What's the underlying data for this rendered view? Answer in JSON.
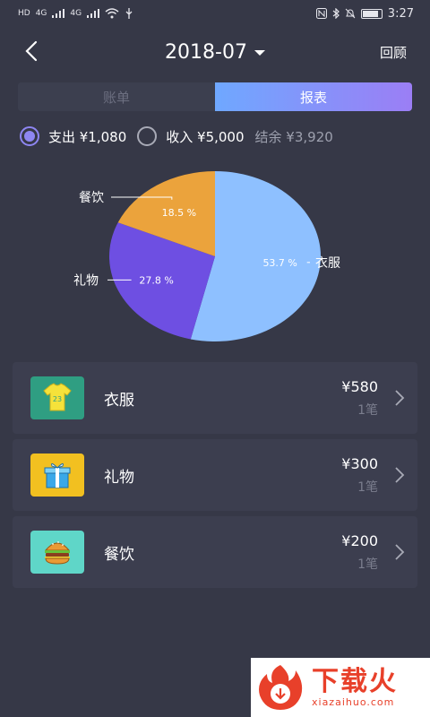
{
  "status_bar": {
    "left_icons": [
      "hd-icon",
      "signal-4g-icon",
      "signal-4g-icon",
      "wifi-icon",
      "usb-icon"
    ],
    "left_labels": [
      "HD",
      "4G",
      "4G"
    ],
    "right_icons": [
      "nfc-icon",
      "bluetooth-icon",
      "mute-icon",
      "battery-icon"
    ],
    "time": "3:27",
    "battery_level": 0.85
  },
  "nav": {
    "title": "2018-07",
    "review_label": "回顾"
  },
  "tabs": [
    {
      "label": "账单",
      "active": false
    },
    {
      "label": "报表",
      "active": true
    }
  ],
  "filter": {
    "expense_label": "支出 ¥1,080",
    "income_label": "收入 ¥5,000",
    "balance_label": "结余 ¥3,920",
    "selected": "expense"
  },
  "chart_data": {
    "type": "pie",
    "series": [
      {
        "name": "衣服",
        "value": 53.7,
        "label": "53.7 %",
        "color": "#8ec0ff"
      },
      {
        "name": "礼物",
        "value": 27.8,
        "label": "27.8 %",
        "color": "#6e4fe2"
      },
      {
        "name": "餐饮",
        "value": 18.5,
        "label": "18.5 %",
        "color": "#eba33c"
      }
    ]
  },
  "items": [
    {
      "name": "衣服",
      "amount": "¥580",
      "count": "1笔",
      "icon": "shirt-icon",
      "bg": "#2f9e82"
    },
    {
      "name": "礼物",
      "amount": "¥300",
      "count": "1笔",
      "icon": "gift-icon",
      "bg": "#f2c020"
    },
    {
      "name": "餐饮",
      "amount": "¥200",
      "count": "1笔",
      "icon": "burger-icon",
      "bg": "#5fd6c8"
    }
  ],
  "watermark": {
    "text_cn": "下载火",
    "text_en": "xiazaihuo.com"
  }
}
